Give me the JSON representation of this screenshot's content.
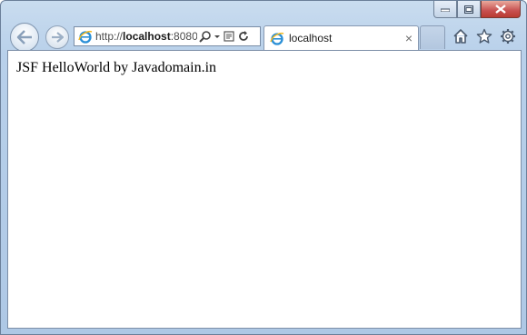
{
  "window": {
    "caption_buttons": [
      "minimize",
      "maximize",
      "close"
    ]
  },
  "navigation": {
    "back_icon": "back-arrow-icon",
    "forward_icon": "forward-arrow-icon"
  },
  "address_bar": {
    "url_prefix": "http://",
    "url_host": "localhost",
    "url_suffix": ":8080",
    "icons": [
      "search-icon",
      "dropdown-icon",
      "compatibility-icon",
      "refresh-icon"
    ]
  },
  "tab": {
    "title": "localhost",
    "close_glyph": "×"
  },
  "toolbar": {
    "icons": [
      "home-icon",
      "favorites-star-icon",
      "settings-gear-icon"
    ]
  },
  "page": {
    "text": "JSF HelloWorld by Javadomain.in"
  },
  "colors": {
    "frame": "#b8d0ea",
    "close_button": "#c75050",
    "ie_logo": "#2a8fd6"
  }
}
